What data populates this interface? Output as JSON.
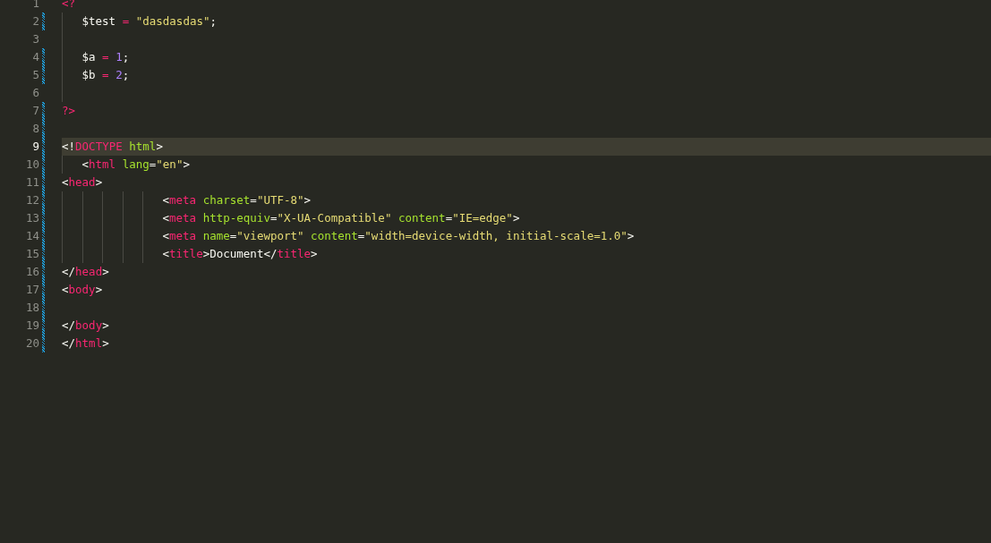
{
  "lines": [
    {
      "number": "1",
      "modified": false,
      "current": false,
      "tokens": [
        {
          "kind": "tag",
          "text": "<?"
        }
      ]
    },
    {
      "number": "2",
      "modified": true,
      "current": false,
      "tokens": [
        {
          "kind": "text",
          "text": "\t$test "
        },
        {
          "kind": "operator",
          "text": "="
        },
        {
          "kind": "string",
          "text": " \"dasdasdas\""
        },
        {
          "kind": "text",
          "text": ";"
        }
      ]
    },
    {
      "number": "3",
      "modified": false,
      "current": false,
      "guide": true
    },
    {
      "number": "4",
      "modified": true,
      "current": false,
      "tokens": [
        {
          "kind": "text",
          "text": "\t$a "
        },
        {
          "kind": "operator",
          "text": "="
        },
        {
          "kind": "number",
          "text": " 1"
        },
        {
          "kind": "text",
          "text": ";"
        }
      ]
    },
    {
      "number": "5",
      "modified": true,
      "current": false,
      "tokens": [
        {
          "kind": "text",
          "text": "\t$b "
        },
        {
          "kind": "operator",
          "text": "="
        },
        {
          "kind": "number",
          "text": " 2"
        },
        {
          "kind": "text",
          "text": ";"
        }
      ]
    },
    {
      "number": "6",
      "modified": false,
      "current": false,
      "guide": true
    },
    {
      "number": "7",
      "modified": true,
      "current": false,
      "tokens": [
        {
          "kind": "tag",
          "text": "?>"
        }
      ]
    },
    {
      "number": "8",
      "modified": true,
      "current": false
    },
    {
      "number": "9",
      "modified": true,
      "current": true,
      "tokens": [
        {
          "kind": "text",
          "text": "<!"
        },
        {
          "kind": "tag",
          "text": "DOCTYPE"
        },
        {
          "kind": "attr",
          "text": " html"
        },
        {
          "kind": "text",
          "text": ">"
        }
      ]
    },
    {
      "number": "10",
      "modified": true,
      "current": false,
      "tokens": [
        {
          "kind": "text",
          "text": "\t<"
        },
        {
          "kind": "tag",
          "text": "html"
        },
        {
          "kind": "attr",
          "text": " lang"
        },
        {
          "kind": "text",
          "text": "="
        },
        {
          "kind": "string",
          "text": "\"en\""
        },
        {
          "kind": "text",
          "text": ">"
        }
      ]
    },
    {
      "number": "11",
      "modified": true,
      "current": false,
      "tokens": [
        {
          "kind": "text",
          "text": "<"
        },
        {
          "kind": "tag",
          "text": "head"
        },
        {
          "kind": "text",
          "text": ">"
        }
      ]
    },
    {
      "number": "12",
      "modified": true,
      "current": false,
      "tokens": [
        {
          "kind": "text",
          "text": "\t\t\t\t\t<"
        },
        {
          "kind": "tag",
          "text": "meta"
        },
        {
          "kind": "attr",
          "text": " charset"
        },
        {
          "kind": "text",
          "text": "="
        },
        {
          "kind": "string",
          "text": "\"UTF-8\""
        },
        {
          "kind": "text",
          "text": ">"
        }
      ]
    },
    {
      "number": "13",
      "modified": true,
      "current": false,
      "tokens": [
        {
          "kind": "text",
          "text": "\t\t\t\t\t<"
        },
        {
          "kind": "tag",
          "text": "meta"
        },
        {
          "kind": "attr",
          "text": " http-equiv"
        },
        {
          "kind": "text",
          "text": "="
        },
        {
          "kind": "string",
          "text": "\"X-UA-Compatible\""
        },
        {
          "kind": "attr",
          "text": " content"
        },
        {
          "kind": "text",
          "text": "="
        },
        {
          "kind": "string",
          "text": "\"IE=edge\""
        },
        {
          "kind": "text",
          "text": ">"
        }
      ]
    },
    {
      "number": "14",
      "modified": true,
      "current": false,
      "tokens": [
        {
          "kind": "text",
          "text": "\t\t\t\t\t<"
        },
        {
          "kind": "tag",
          "text": "meta"
        },
        {
          "kind": "attr",
          "text": " name"
        },
        {
          "kind": "text",
          "text": "="
        },
        {
          "kind": "string",
          "text": "\"viewport\""
        },
        {
          "kind": "attr",
          "text": " content"
        },
        {
          "kind": "text",
          "text": "="
        },
        {
          "kind": "string",
          "text": "\"width=device-width, initial-scale=1.0\""
        },
        {
          "kind": "text",
          "text": ">"
        }
      ]
    },
    {
      "number": "15",
      "modified": true,
      "current": false,
      "tokens": [
        {
          "kind": "text",
          "text": "\t\t\t\t\t<"
        },
        {
          "kind": "tag",
          "text": "title"
        },
        {
          "kind": "text",
          "text": ">Document</"
        },
        {
          "kind": "tag",
          "text": "title"
        },
        {
          "kind": "text",
          "text": ">"
        }
      ]
    },
    {
      "number": "16",
      "modified": true,
      "current": false,
      "tokens": [
        {
          "kind": "text",
          "text": "</"
        },
        {
          "kind": "tag",
          "text": "head"
        },
        {
          "kind": "text",
          "text": ">"
        }
      ]
    },
    {
      "number": "17",
      "modified": true,
      "current": false,
      "tokens": [
        {
          "kind": "text",
          "text": "<"
        },
        {
          "kind": "tag",
          "text": "body"
        },
        {
          "kind": "text",
          "text": ">"
        }
      ]
    },
    {
      "number": "18",
      "modified": true,
      "current": false
    },
    {
      "number": "19",
      "modified": true,
      "current": false,
      "tokens": [
        {
          "kind": "text",
          "text": "</"
        },
        {
          "kind": "tag",
          "text": "body"
        },
        {
          "kind": "text",
          "text": ">"
        }
      ]
    },
    {
      "number": "20",
      "modified": true,
      "current": false,
      "tokens": [
        {
          "kind": "text",
          "text": "</"
        },
        {
          "kind": "tag",
          "text": "html"
        },
        {
          "kind": "text",
          "text": ">"
        }
      ]
    }
  ]
}
